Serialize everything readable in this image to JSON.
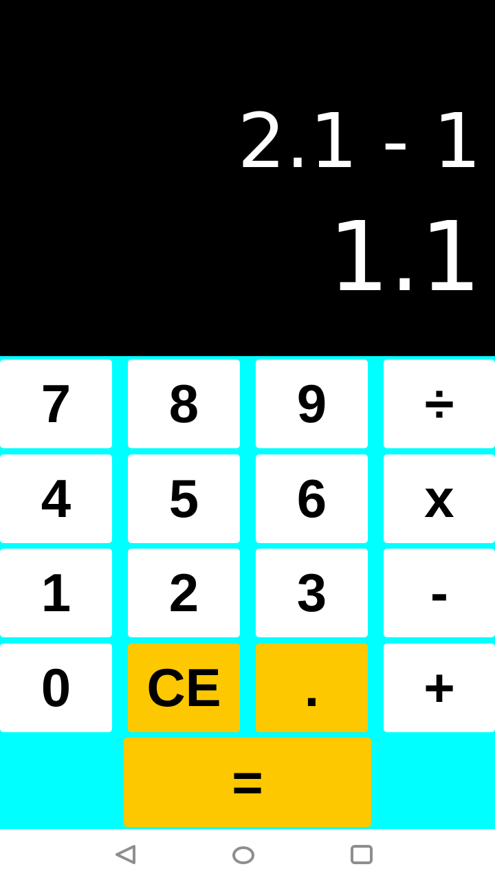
{
  "display": {
    "expression": "2.1 - 1",
    "result": "1.1"
  },
  "keys": [
    {
      "label": "7"
    },
    {
      "label": "8"
    },
    {
      "label": "9"
    },
    {
      "label": "÷"
    },
    {
      "label": "4"
    },
    {
      "label": "5"
    },
    {
      "label": "6"
    },
    {
      "label": "x"
    },
    {
      "label": "1"
    },
    {
      "label": "2"
    },
    {
      "label": "3"
    },
    {
      "label": "-"
    },
    {
      "label": "0"
    },
    {
      "label": "CE"
    },
    {
      "label": "."
    },
    {
      "label": "+"
    }
  ],
  "equals": {
    "label": "="
  },
  "colors": {
    "display_bg": "#000000",
    "keypad_bg": "#00ffff",
    "key_bg": "#ffffff",
    "accent_key_bg": "#fdc800"
  },
  "nav": {
    "icons": [
      "back-icon",
      "home-icon",
      "recents-icon"
    ]
  }
}
